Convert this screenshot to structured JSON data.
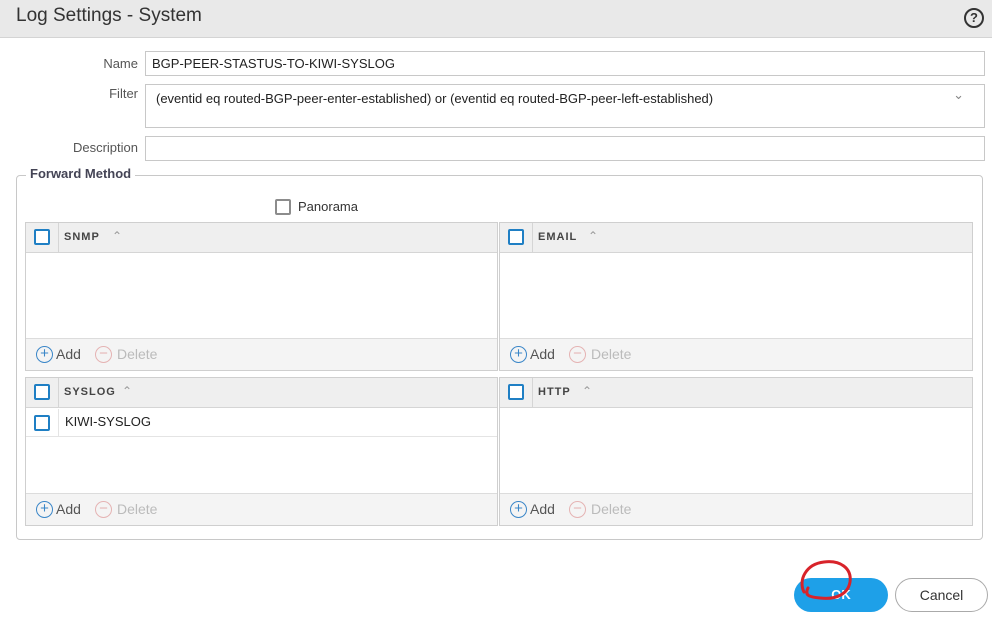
{
  "window": {
    "title": "Log Settings - System",
    "help_glyph": "?"
  },
  "form": {
    "name_label": "Name",
    "name_value": "BGP-PEER-STASTUS-TO-KIWI-SYSLOG",
    "filter_label": "Filter",
    "filter_value": "(eventid eq routed-BGP-peer-enter-established) or (eventid eq routed-BGP-peer-left-established)",
    "description_label": "Description",
    "description_value": ""
  },
  "forward_method": {
    "legend": "Forward Method",
    "panorama_label": "Panorama",
    "panels": {
      "snmp": {
        "title": "SNMP",
        "rows": []
      },
      "email": {
        "title": "EMAIL",
        "rows": []
      },
      "syslog": {
        "title": "SYSLOG",
        "rows": [
          "KIWI-SYSLOG"
        ]
      },
      "http": {
        "title": "HTTP",
        "rows": []
      }
    },
    "add_label": "Add",
    "delete_label": "Delete"
  },
  "buttons": {
    "ok_label": "OK",
    "cancel_label": "Cancel"
  },
  "colors": {
    "accent": "#1ea0e8",
    "checkbox": "#1f7fc4",
    "annotation": "#d8232a"
  }
}
